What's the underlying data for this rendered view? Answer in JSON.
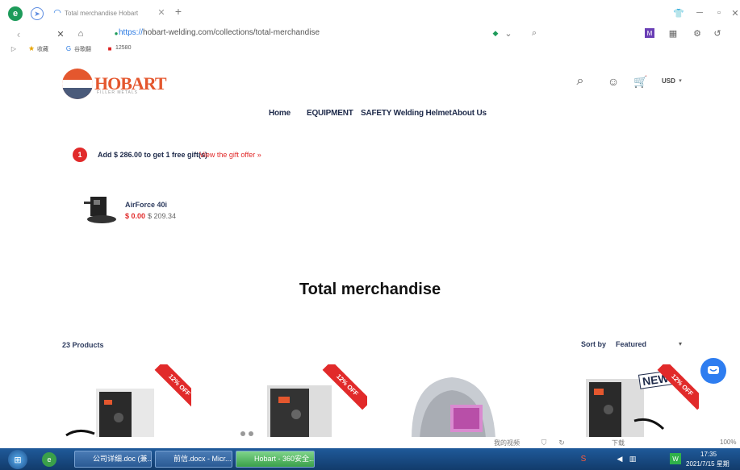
{
  "browser": {
    "tab_title": "Total merchandise Hobart",
    "url_prefix": "https://",
    "url_rest": "hobart-welding.com/collections/total-merchandise",
    "bookmarks": [
      "收藏",
      "谷歌翻",
      "12580"
    ],
    "status_items": [
      "我的视频",
      "下载",
      "100%"
    ]
  },
  "site": {
    "logo": "HOBART",
    "logo_sub": "FILLER METALS",
    "nav": [
      "Home",
      "EQUIPMENT",
      "SAFETY Welding Helmet",
      "About Us"
    ],
    "currency": "USD",
    "promo_badge": "1",
    "promo_text": "Add $ 286.00 to get 1 free gift(s)",
    "promo_link": "View the gift offer »",
    "gift_product": {
      "name": "AirForce 40i",
      "sale_price": "$ 0.00",
      "orig_price": "$ 209.34"
    },
    "heading": "Total merchandise",
    "product_count": "23 Products",
    "sort_label": "Sort by",
    "sort_value": "Featured",
    "cards": [
      {
        "badge": "12% OFF"
      },
      {
        "badge": "12% OFF"
      },
      {
        "badge": ""
      },
      {
        "badge": "12% OFF",
        "new": "NEW"
      }
    ]
  },
  "taskbar": {
    "items": [
      "公司详细.doc (兼...",
      "前信.docx - Micr...",
      "Hobart - 360安全..."
    ],
    "clock_time": "17:35",
    "clock_date": "2021/7/15 星期"
  },
  "colors": {
    "brand": "#e4572e",
    "accent_red": "#e12a2a",
    "nav": "#1e2a4a",
    "chat": "#2e7df0"
  }
}
